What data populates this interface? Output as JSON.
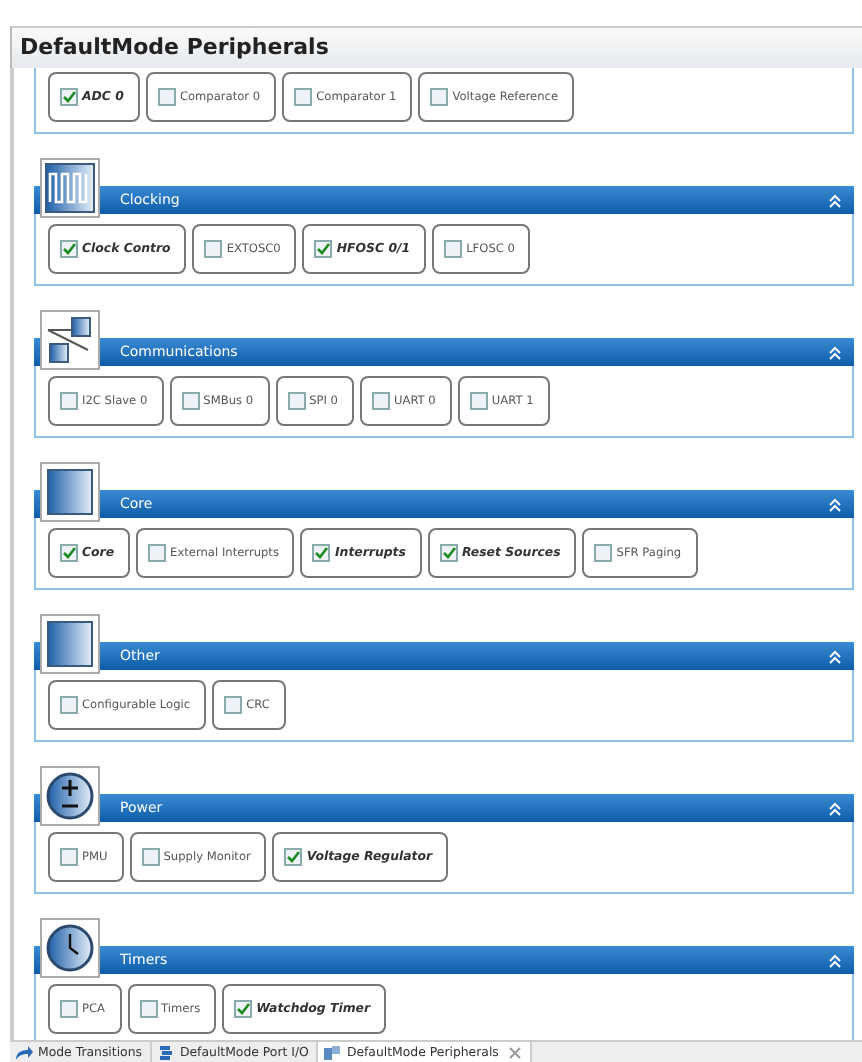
{
  "window": {
    "title": "DefaultMode Peripherals"
  },
  "sections": [
    {
      "items": [
        {
          "label": "ADC 0",
          "checked": true
        },
        {
          "label": "Comparator 0",
          "checked": false
        },
        {
          "label": "Comparator 1",
          "checked": false
        },
        {
          "label": "Voltage Reference",
          "checked": false
        }
      ]
    },
    {
      "title": "Clocking",
      "items": [
        {
          "label": "Clock Contro",
          "checked": true
        },
        {
          "label": "EXTOSC0",
          "checked": false
        },
        {
          "label": "HFOSC 0/1",
          "checked": true
        },
        {
          "label": "LFOSC 0",
          "checked": false
        }
      ]
    },
    {
      "title": "Communications",
      "items": [
        {
          "label": "I2C Slave 0",
          "checked": false
        },
        {
          "label": "SMBus 0",
          "checked": false
        },
        {
          "label": "SPI 0",
          "checked": false
        },
        {
          "label": "UART 0",
          "checked": false
        },
        {
          "label": "UART 1",
          "checked": false
        }
      ]
    },
    {
      "title": "Core",
      "items": [
        {
          "label": "Core",
          "checked": true
        },
        {
          "label": "External Interrupts",
          "checked": false
        },
        {
          "label": "Interrupts",
          "checked": true
        },
        {
          "label": "Reset Sources",
          "checked": true
        },
        {
          "label": "SFR Paging",
          "checked": false
        }
      ]
    },
    {
      "title": "Other",
      "items": [
        {
          "label": "Configurable Logic",
          "checked": false
        },
        {
          "label": "CRC",
          "checked": false
        }
      ]
    },
    {
      "title": "Power",
      "items": [
        {
          "label": "PMU",
          "checked": false
        },
        {
          "label": "Supply Monitor",
          "checked": false
        },
        {
          "label": "Voltage Regulator",
          "checked": true
        }
      ]
    },
    {
      "title": "Timers",
      "items": [
        {
          "label": "PCA",
          "checked": false
        },
        {
          "label": "Timers",
          "checked": false
        },
        {
          "label": "Watchdog Timer",
          "checked": true
        }
      ]
    }
  ],
  "tabs": [
    {
      "label": "Mode Transitions",
      "selected": false
    },
    {
      "label": "DefaultMode Port I/O",
      "selected": false
    },
    {
      "label": "DefaultMode Peripherals",
      "selected": true
    }
  ]
}
